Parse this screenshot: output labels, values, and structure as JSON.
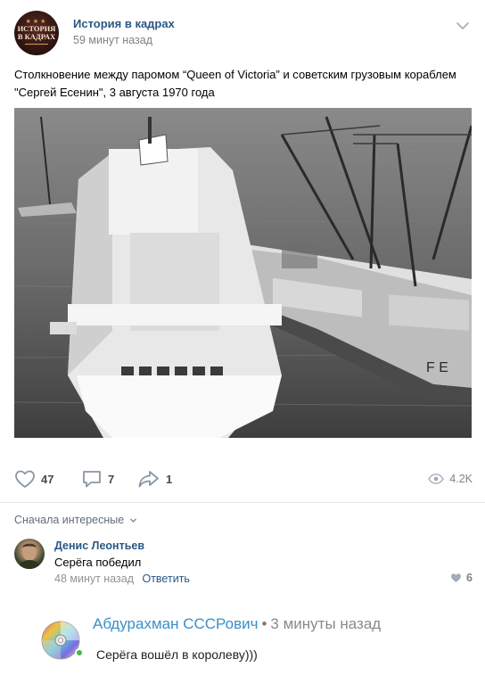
{
  "post": {
    "group_name": "История в кадрах",
    "time": "59 минут назад",
    "avatar_text_line1": "ИСТОРИЯ",
    "avatar_text_line2": "В КАДРАХ",
    "text_line1": "Столкновение между паромом “Queen of Victoria” и советским грузовым кораблем",
    "text_line2": "\"Сергей Есенин\", 3 августа 1970 года",
    "photo_hull_lettering": "F E"
  },
  "actions": {
    "likes": "47",
    "comments": "7",
    "shares": "1",
    "views": "4.2K"
  },
  "comments_sort": "Сначала интересные",
  "comment1": {
    "author": "Денис Леонтьев",
    "text": "Серёга победил",
    "time": "48 минут назад",
    "reply_label": "Ответить",
    "likes": "6"
  },
  "comment2": {
    "author": "Абдурахман СССРович",
    "separator": "•",
    "time": "3 минуты назад",
    "text": "Серёга вошёл в королеву)))"
  },
  "icons": {
    "more": "chevron-down-icon",
    "like": "heart-icon",
    "comment": "comment-bubble-icon",
    "share": "share-arrow-icon",
    "views": "eye-icon",
    "sort": "chevron-down-icon",
    "avatar2": "cd-disc-icon",
    "online": "online-dot"
  },
  "colors": {
    "link": "#2a5885",
    "muted": "#828282",
    "online": "#4bb34b",
    "comment2_name": "#3a8fc7"
  }
}
